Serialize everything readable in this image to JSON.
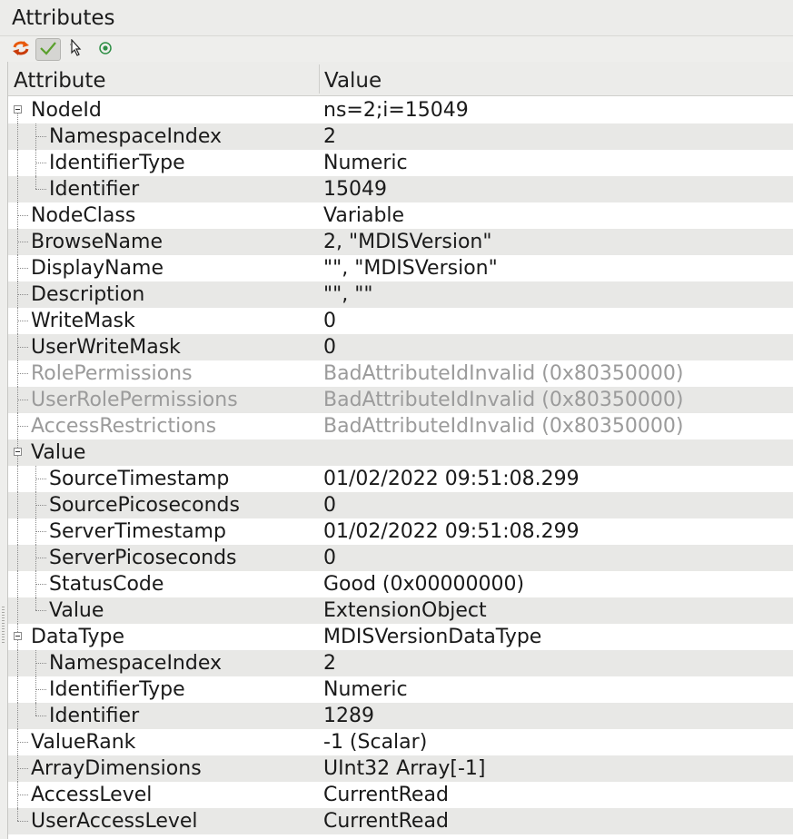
{
  "panel": {
    "title": "Attributes"
  },
  "toolbar": {
    "buttons": [
      {
        "icon": "refresh-icon"
      },
      {
        "icon": "checkmark-icon"
      },
      {
        "icon": "pointer-icon"
      },
      {
        "icon": "radio-target-icon"
      }
    ]
  },
  "table": {
    "headers": {
      "attribute": "Attribute",
      "value": "Value"
    },
    "rows": [
      {
        "level": 0,
        "expander": true,
        "name": "NodeId",
        "value": "ns=2;i=15049"
      },
      {
        "level": 1,
        "name": "NamespaceIndex",
        "value": "2"
      },
      {
        "level": 1,
        "name": "IdentifierType",
        "value": "Numeric"
      },
      {
        "level": 1,
        "name": "Identifier",
        "value": "15049"
      },
      {
        "level": 0,
        "name": "NodeClass",
        "value": "Variable"
      },
      {
        "level": 0,
        "name": "BrowseName",
        "value": "2, \"MDISVersion\""
      },
      {
        "level": 0,
        "name": "DisplayName",
        "value": "\"\", \"MDISVersion\""
      },
      {
        "level": 0,
        "name": "Description",
        "value": "\"\", \"\""
      },
      {
        "level": 0,
        "name": "WriteMask",
        "value": "0"
      },
      {
        "level": 0,
        "name": "UserWriteMask",
        "value": "0"
      },
      {
        "level": 0,
        "disabled": true,
        "name": "RolePermissions",
        "value": "BadAttributeIdInvalid (0x80350000)"
      },
      {
        "level": 0,
        "disabled": true,
        "name": "UserRolePermissions",
        "value": "BadAttributeIdInvalid (0x80350000)"
      },
      {
        "level": 0,
        "disabled": true,
        "name": "AccessRestrictions",
        "value": "BadAttributeIdInvalid (0x80350000)"
      },
      {
        "level": 0,
        "expander": true,
        "name": "Value",
        "value": ""
      },
      {
        "level": 1,
        "name": "SourceTimestamp",
        "value": "01/02/2022 09:51:08.299"
      },
      {
        "level": 1,
        "name": "SourcePicoseconds",
        "value": "0"
      },
      {
        "level": 1,
        "name": "ServerTimestamp",
        "value": "01/02/2022 09:51:08.299"
      },
      {
        "level": 1,
        "name": "ServerPicoseconds",
        "value": "0"
      },
      {
        "level": 1,
        "name": "StatusCode",
        "value": "Good (0x00000000)"
      },
      {
        "level": 1,
        "name": "Value",
        "value": "ExtensionObject"
      },
      {
        "level": 0,
        "expander": true,
        "name": "DataType",
        "value": "MDISVersionDataType"
      },
      {
        "level": 1,
        "name": "NamespaceIndex",
        "value": "2"
      },
      {
        "level": 1,
        "name": "IdentifierType",
        "value": "Numeric"
      },
      {
        "level": 1,
        "name": "Identifier",
        "value": "1289"
      },
      {
        "level": 0,
        "name": "ValueRank",
        "value": "-1 (Scalar)"
      },
      {
        "level": 0,
        "name": "ArrayDimensions",
        "value": "UInt32 Array[-1]"
      },
      {
        "level": 0,
        "name": "AccessLevel",
        "value": "CurrentRead"
      },
      {
        "level": 0,
        "name": "UserAccessLevel",
        "value": "CurrentRead"
      }
    ]
  }
}
